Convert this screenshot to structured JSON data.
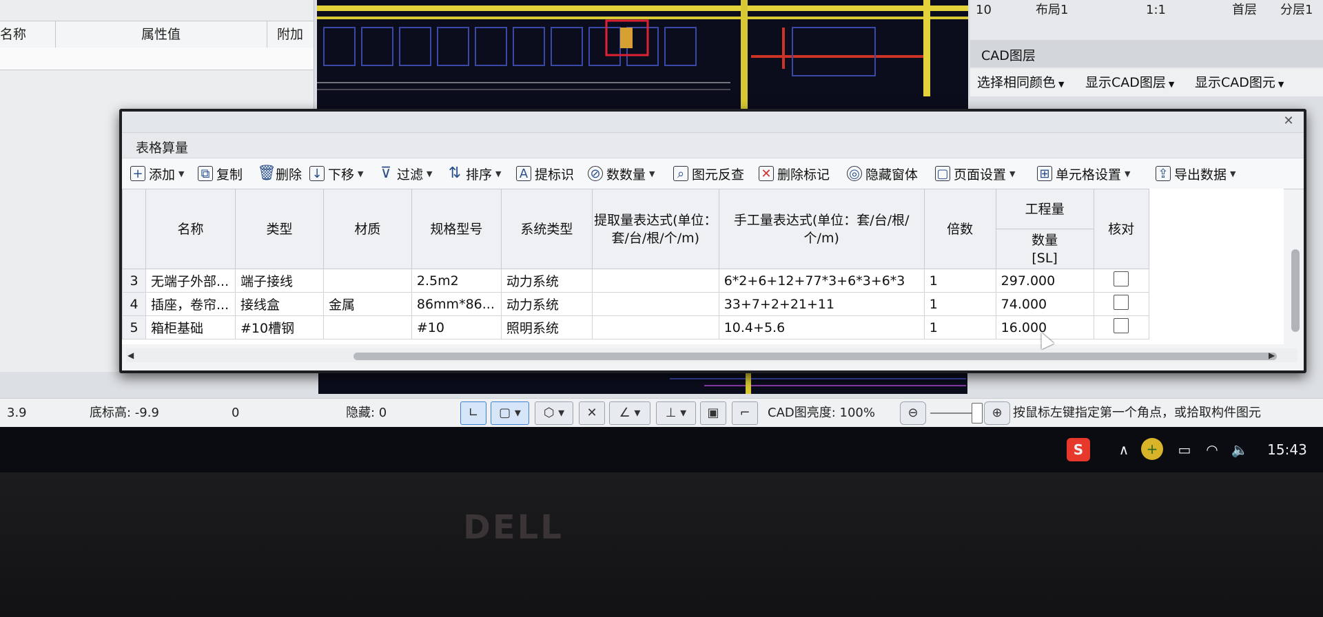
{
  "prop_panel": {
    "col_name": "名称",
    "col_value": "属性值",
    "col_extra": "附加"
  },
  "right_panel": {
    "row_num": "10",
    "layout": "布局1",
    "scale": "1:1",
    "floor": "首层",
    "extra": "分层1"
  },
  "layers": {
    "title": "CAD图层",
    "select_same_color": "选择相同颜色",
    "show_cad_layer": "显示CAD图层",
    "show_cad_element": "显示CAD图元"
  },
  "dialog": {
    "caption": "表格算量",
    "toolbar": {
      "add": "添加",
      "copy": "复制",
      "delete": "删除",
      "move_down": "下移",
      "filter": "过滤",
      "sort": "排序",
      "extract_mark": "提标识",
      "count": "数数量",
      "element_check": "图元反查",
      "delete_mark": "删除标记",
      "hide_window": "隐藏窗体",
      "page_setup": "页面设置",
      "cell_setup": "单元格设置",
      "export": "导出数据"
    },
    "columns": {
      "name": "名称",
      "type": "类型",
      "material": "材质",
      "spec": "规格型号",
      "system": "系统类型",
      "extract_expr": "提取量表达式(单位：套/台/根/个/m)",
      "manual_expr": "手工量表达式(单位：套/台/根/个/m)",
      "multiplier": "倍数",
      "quantity_group": "工程量",
      "quantity": "数量\n[SL]",
      "check": "核对"
    },
    "rows": [
      {
        "no": "3",
        "name": "无端子外部...",
        "type": "端子接线",
        "material": "",
        "spec": "2.5m2",
        "system": "动力系统",
        "extract": "",
        "manual": "6*2+6+12+77*3+6*3+6*3",
        "mult": "1",
        "qty": "297.000",
        "checked": false
      },
      {
        "no": "4",
        "name": "插座，卷帘...",
        "type": "接线盒",
        "material": "金属",
        "spec": "86mm*86...",
        "system": "动力系统",
        "extract": "",
        "manual": "33+7+2+21+11",
        "mult": "1",
        "qty": "74.000",
        "checked": false
      },
      {
        "no": "5",
        "name": "箱柜基础",
        "type": "#10槽钢",
        "material": "",
        "spec": "#10",
        "system": "照明系统",
        "extract": "",
        "manual": "10.4+5.6",
        "mult": "1",
        "qty": "16.000",
        "checked": false
      }
    ]
  },
  "status": {
    "left_value": "3.9",
    "bottom_elev_label": "底标高: -9.9",
    "zero": "0",
    "hidden": "隐藏: 0",
    "cad_brightness": "CAD图亮度: 100%",
    "hint": "按鼠标左键指定第一个角点，或拾取构件图元"
  },
  "taskbar": {
    "time": "15:43"
  },
  "bezel": {
    "brand": "DELL"
  }
}
